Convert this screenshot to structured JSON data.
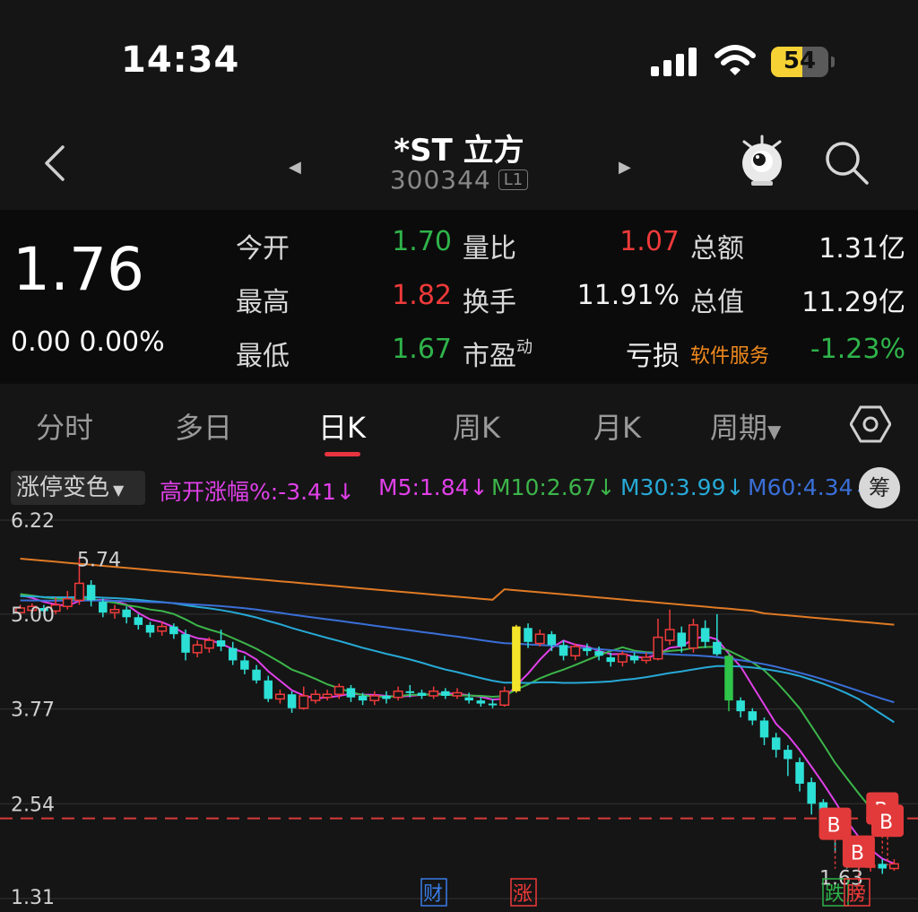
{
  "status_bar": {
    "time": "14:34",
    "battery": "54",
    "battery_level": 0.54
  },
  "header": {
    "name": "*ST 立方",
    "code": "300344",
    "market_tag": "L1"
  },
  "quote": {
    "price": "1.76",
    "change": "0.00 0.00%",
    "open_label": "今开",
    "open": "1.70",
    "high_label": "最高",
    "high": "1.82",
    "low_label": "最低",
    "low": "1.67",
    "vol_ratio_label": "量比",
    "vol_ratio": "1.07",
    "turnover_label": "换手",
    "turnover": "11.91%",
    "pe_label": "市盈",
    "pe_sup": "动",
    "pe": "亏损",
    "amount_label": "总额",
    "amount": "1.31亿",
    "mktcap_label": "总值",
    "mktcap": "11.29亿",
    "industry": "软件服务",
    "industry_change": "-1.23%"
  },
  "tabs": [
    "分时",
    "多日",
    "日K",
    "周K",
    "月K",
    "周期"
  ],
  "active_tab": "日K",
  "indicator_bar": {
    "color_select": "涨停变色",
    "gap_label": "高开涨幅%:-3.41↓",
    "m5": "M5:1.84↓",
    "m10": "M10:2.67↓",
    "m30": "M30:3.99↓",
    "m60": "M60:4.34↓",
    "chip": "筹"
  },
  "colors": {
    "up": "#ef3a3a",
    "down": "#2de0d6",
    "m5": "#e040e8",
    "m10": "#3cb54a",
    "m30": "#27a9d6",
    "m60": "#3a6fd8",
    "ma_long": "#e07a24",
    "accent": "#e8343f"
  },
  "chart_data": {
    "type": "candlestick",
    "y_axis_ticks": [
      "6.22",
      "5.00",
      "3.77",
      "2.54",
      "1.31"
    ],
    "y_range": [
      1.31,
      6.22
    ],
    "high_marker": "5.74",
    "low_marker": "1.63",
    "event_tags": [
      "财",
      "涨",
      "跌",
      "膀"
    ],
    "buy_marker": "B",
    "candles": [
      [
        5.02,
        5.08,
        5.12,
        4.98
      ],
      [
        5.05,
        5.1,
        5.14,
        5.0
      ],
      [
        5.08,
        5.04,
        5.12,
        4.98
      ],
      [
        5.04,
        5.12,
        5.22,
        5.0
      ],
      [
        5.1,
        5.2,
        5.3,
        5.06
      ],
      [
        5.18,
        5.4,
        5.74,
        5.12
      ],
      [
        5.38,
        5.18,
        5.44,
        5.1
      ],
      [
        5.16,
        5.02,
        5.2,
        4.96
      ],
      [
        5.02,
        5.06,
        5.12,
        4.94
      ],
      [
        5.06,
        4.96,
        5.1,
        4.88
      ],
      [
        4.96,
        4.86,
        5.0,
        4.8
      ],
      [
        4.86,
        4.76,
        4.9,
        4.7
      ],
      [
        4.78,
        4.84,
        4.9,
        4.72
      ],
      [
        4.84,
        4.74,
        4.88,
        4.68
      ],
      [
        4.74,
        4.5,
        4.8,
        4.4
      ],
      [
        4.5,
        4.6,
        4.66,
        4.44
      ],
      [
        4.56,
        4.66,
        4.7,
        4.5
      ],
      [
        4.66,
        4.58,
        4.8,
        4.52
      ],
      [
        4.56,
        4.4,
        4.64,
        4.34
      ],
      [
        4.4,
        4.28,
        4.46,
        4.22
      ],
      [
        4.28,
        4.14,
        4.34,
        4.1
      ],
      [
        4.14,
        3.9,
        4.2,
        3.86
      ],
      [
        3.9,
        3.96,
        4.02,
        3.84
      ],
      [
        3.96,
        3.78,
        4.0,
        3.72
      ],
      [
        3.78,
        3.94,
        4.06,
        3.76
      ],
      [
        3.88,
        3.96,
        4.02,
        3.84
      ],
      [
        3.92,
        3.96,
        4.02,
        3.88
      ],
      [
        3.96,
        4.06,
        4.1,
        3.9
      ],
      [
        4.04,
        3.92,
        4.08,
        3.86
      ],
      [
        3.94,
        3.88,
        3.98,
        3.82
      ],
      [
        3.88,
        3.94,
        4.0,
        3.82
      ],
      [
        3.94,
        3.9,
        4.0,
        3.84
      ],
      [
        3.92,
        4.0,
        4.06,
        3.88
      ],
      [
        4.0,
        3.98,
        4.08,
        3.92
      ],
      [
        3.98,
        3.94,
        4.02,
        3.9
      ],
      [
        3.94,
        4.0,
        4.06,
        3.9
      ],
      [
        4.0,
        3.94,
        4.04,
        3.9
      ],
      [
        3.94,
        3.98,
        4.04,
        3.9
      ],
      [
        3.92,
        3.88,
        3.98,
        3.84
      ],
      [
        3.88,
        3.84,
        3.92,
        3.8
      ],
      [
        3.84,
        3.82,
        3.9,
        3.78
      ],
      [
        3.82,
        4.0,
        4.06,
        3.8
      ],
      [
        4.0,
        4.84,
        4.86,
        3.98
      ],
      [
        4.82,
        4.64,
        4.88,
        4.56
      ],
      [
        4.62,
        4.74,
        4.8,
        4.58
      ],
      [
        4.74,
        4.6,
        4.78,
        4.52
      ],
      [
        4.6,
        4.46,
        4.66,
        4.4
      ],
      [
        4.46,
        4.58,
        4.62,
        4.4
      ],
      [
        4.56,
        4.52,
        4.62,
        4.46
      ],
      [
        4.52,
        4.46,
        4.58,
        4.4
      ],
      [
        4.44,
        4.38,
        4.5,
        4.32
      ],
      [
        4.38,
        4.48,
        4.52,
        4.32
      ],
      [
        4.46,
        4.4,
        4.5,
        4.36
      ],
      [
        4.4,
        4.44,
        4.5,
        4.36
      ],
      [
        4.42,
        4.7,
        4.94,
        4.4
      ],
      [
        4.66,
        4.8,
        5.06,
        4.6
      ],
      [
        4.76,
        4.58,
        4.84,
        4.5
      ],
      [
        4.56,
        4.86,
        4.94,
        4.5
      ],
      [
        4.82,
        4.64,
        4.92,
        4.56
      ],
      [
        4.64,
        4.48,
        5.0,
        4.46
      ],
      [
        4.46,
        3.88,
        4.5,
        3.74
      ],
      [
        3.88,
        3.74,
        3.92,
        3.66
      ],
      [
        3.74,
        3.62,
        3.78,
        3.56
      ],
      [
        3.62,
        3.4,
        3.66,
        3.3
      ],
      [
        3.4,
        3.24,
        3.46,
        3.14
      ],
      [
        3.24,
        3.12,
        3.3,
        2.9
      ],
      [
        3.08,
        2.8,
        3.14,
        2.7
      ],
      [
        2.82,
        2.54,
        2.88,
        2.4
      ],
      [
        2.56,
        2.3,
        2.6,
        2.1
      ],
      [
        2.3,
        2.08,
        2.34,
        1.9
      ],
      [
        2.06,
        1.86,
        2.12,
        1.7
      ],
      [
        1.86,
        1.76,
        1.9,
        1.68
      ],
      [
        1.72,
        1.74,
        1.78,
        1.66
      ],
      [
        1.76,
        1.7,
        1.82,
        1.63
      ],
      [
        1.7,
        1.76,
        1.82,
        1.67
      ]
    ],
    "dashed_line_price": 2.35
  }
}
